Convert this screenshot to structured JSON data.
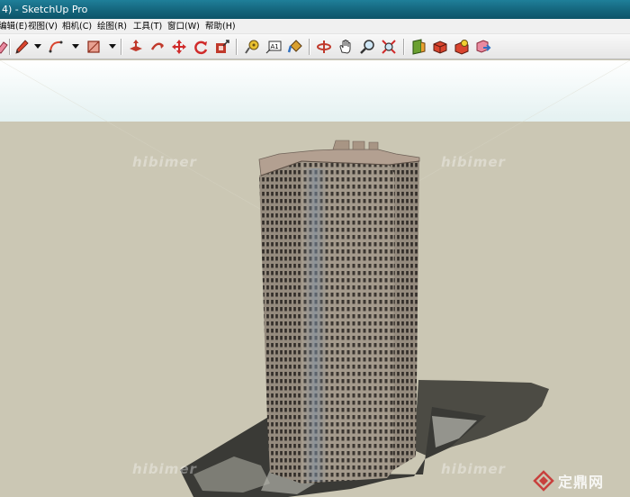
{
  "window": {
    "title": "4) - SketchUp Pro"
  },
  "menu": {
    "items": [
      {
        "label": "编辑(E)"
      },
      {
        "label": "视图(V)"
      },
      {
        "label": "相机(C)"
      },
      {
        "label": "绘图(R)"
      },
      {
        "label": "工具(T)"
      },
      {
        "label": "窗口(W)"
      },
      {
        "label": "帮助(H)"
      }
    ]
  },
  "toolbar": {
    "tools": [
      {
        "icon": "eraser-icon"
      },
      {
        "icon": "pencil-icon"
      },
      {
        "icon": "arc-icon"
      },
      {
        "icon": "rectangle-icon"
      },
      {
        "icon": "push-pull-icon"
      },
      {
        "icon": "follow-me-icon"
      },
      {
        "icon": "move-icon"
      },
      {
        "icon": "rotate-icon"
      },
      {
        "icon": "offset-icon"
      },
      {
        "icon": "tape-measure-icon"
      },
      {
        "icon": "text-icon"
      },
      {
        "icon": "paint-bucket-icon"
      },
      {
        "icon": "orbit-icon"
      },
      {
        "icon": "pan-icon"
      },
      {
        "icon": "zoom-icon"
      },
      {
        "icon": "zoom-extents-icon"
      },
      {
        "icon": "section-plane-icon"
      },
      {
        "icon": "components-icon"
      },
      {
        "icon": "3d-warehouse-icon"
      },
      {
        "icon": "share-model-icon"
      }
    ],
    "text_tool_label": "A1"
  },
  "watermarks": {
    "brand": "hibimer",
    "site_name": "定鼎网"
  },
  "colors": {
    "sky": "#e4f1f1",
    "ground": "#cbc7b4",
    "titlebar": "#14657c",
    "building_face": "#8d8276",
    "shadow": "#4c4b44"
  }
}
